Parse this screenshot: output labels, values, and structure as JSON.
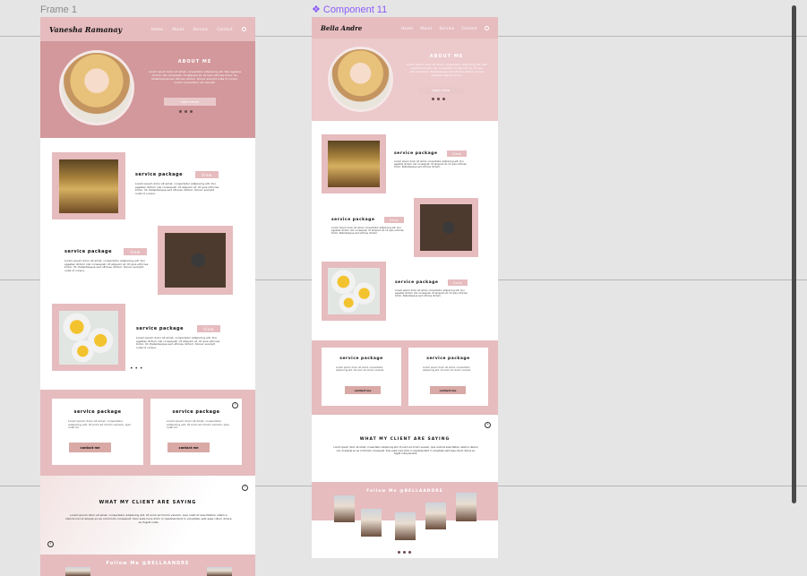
{
  "canvas": {
    "frame1_label": "Frame 1",
    "component_label": "Component 11",
    "component_icon": "component-icon"
  },
  "frame1": {
    "brand": "Vanesha Ramanay",
    "nav": [
      "Home",
      "About",
      "Service",
      "Contact"
    ],
    "about_title": "ABOUT ME",
    "about_text": "Lorem ipsum dolor sit amet, consectetur adipiscing elit. Nec egestas dictum nisl consequat. Ut aliquam et. Ut quis ultricies tortor. Ut. Pellentesque sed ultrices dictum. Donec suscipit nulla id cursus, morbi consectetur vel suscipit.",
    "about_btn": "Learn more",
    "packages": [
      {
        "title": "service package",
        "btn": "View",
        "text": "Lorem ipsum dolor sit amet, consectetur adipiscing elit. Dui egestas dictum nisl consequat. Ut aliquam et. Ut quis ultricies tortor. Ut. Pellentesque sed ultrices dictum. Donec suscipit nulla id cursus."
      },
      {
        "title": "service package",
        "btn": "View",
        "text": "Lorem ipsum dolor sit amet, consectetur adipiscing elit. Dui egestas dictum nisl consequat. Ut aliquam et. Ut quis ultricies tortor. Ut. Pellentesque sed ultrices dictum. Donec suscipit nulla id cursus."
      },
      {
        "title": "service package",
        "btn": "View",
        "text": "Lorem ipsum dolor sit amet, consectetur adipiscing elit. Dui egestas dictum nisl consequat. Ut aliquam et. Ut quis ultricies tortor. Ut. Pellentesque sed ultrices dictum. Donec suscipit nulla id cursus."
      }
    ],
    "cards": [
      {
        "title": "service package",
        "text": "Lorem ipsum dolor sit amet, consectetur adipiscing elit. Ut enim ad minim veniam, quis nostrud.",
        "btn": "contact me"
      },
      {
        "title": "service package",
        "text": "Lorem ipsum dolor sit amet, consectetur adipiscing elit. Ut enim ad minim veniam, quis nostrud.",
        "btn": "contact me"
      }
    ],
    "testi_title": "WHAT MY CLIENT ARE SAYING",
    "testi_text": "Lorem ipsum dolor sit amet, consectetur adipiscing elit. Ut enim ad minim veniam, quis nostrud exercitation ullamco laboris nisi ut aliquip ex ea commodo consequat. Duis aute irure dolor in reprehenderit in voluptate velit esse cillum dolore eu fugiat nulla.",
    "follow": "Follow Me @BELLAANDRE"
  },
  "component": {
    "brand": "Bella Andre",
    "nav": [
      "Home",
      "About",
      "Service",
      "Contact"
    ],
    "about_title": "ABOUT ME",
    "about_text": "Lorem ipsum dolor sit amet, consectetur adipiscing elit. Nec egestas dictum nisl consequat. Ut aliquam et. Ut quis ultricies tortor. Pellentesque sed ultrices dictum. Donec suscipit nulla id cursus.",
    "about_btn": "Learn more",
    "packages": [
      {
        "title": "service package",
        "btn": "View",
        "text": "Lorem ipsum dolor sit amet, consectetur adipiscing elit. Dui egestas dictum nisl consequat. Ut aliquam et. Ut quis ultricies tortor. Pellentesque sed ultrices dictum."
      },
      {
        "title": "service package",
        "btn": "View",
        "text": "Lorem ipsum dolor sit amet, consectetur adipiscing elit. Dui egestas dictum nisl consequat. Ut aliquam et. Ut quis ultricies tortor. Pellentesque sed ultrices dictum."
      },
      {
        "title": "service package",
        "btn": "View",
        "text": "Lorem ipsum dolor sit amet, consectetur adipiscing elit. Dui egestas dictum nisl consequat. Ut aliquam et. Ut quis ultricies tortor. Pellentesque sed ultrices dictum."
      }
    ],
    "cards": [
      {
        "title": "service package",
        "text": "Lorem ipsum dolor sit amet, consectetur adipiscing elit. Ut enim ad minim veniam.",
        "btn": "contact me"
      },
      {
        "title": "service package",
        "text": "Lorem ipsum dolor sit amet, consectetur adipiscing elit. Ut enim ad minim veniam.",
        "btn": "contact me"
      }
    ],
    "testi_title": "WHAT MY CLIENT ARE SAYING",
    "testi_text": "Lorem ipsum dolor sit amet, consectetur adipiscing elit. Ut enim ad minim veniam, quis nostrud exercitation ullamco laboris nisi ut aliquip ex ea commodo consequat. Duis aute irure dolor in reprehenderit in voluptate velit esse cillum dolore eu fugiat nulla pariatur.",
    "follow": "Follow Me @BELLAANDRE"
  },
  "colors": {
    "accent_pink": "#e6bcbf",
    "accent_rose": "#d2989b",
    "component_purple": "#8b5cf6"
  }
}
